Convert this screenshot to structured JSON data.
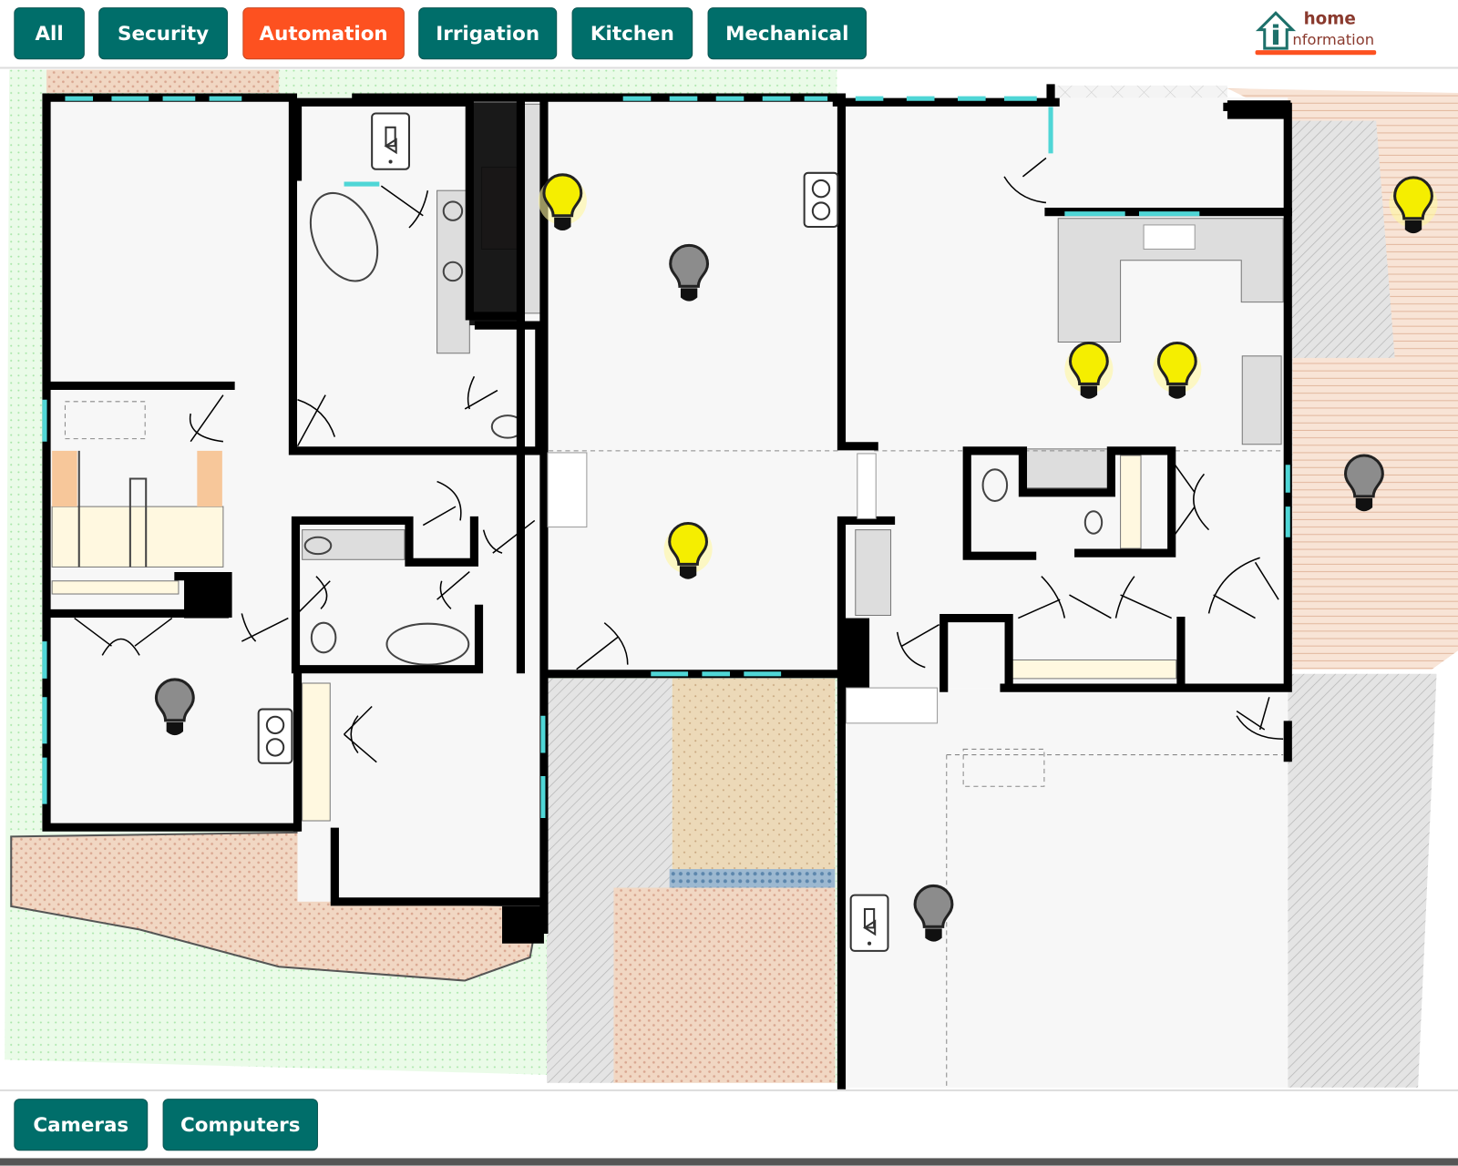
{
  "top_nav": {
    "buttons": [
      {
        "label": "All",
        "active": false
      },
      {
        "label": "Security",
        "active": false
      },
      {
        "label": "Automation",
        "active": true
      },
      {
        "label": "Irrigation",
        "active": false
      },
      {
        "label": "Kitchen",
        "active": false
      },
      {
        "label": "Mechanical",
        "active": false
      }
    ]
  },
  "logo": {
    "line1": "home",
    "line2": "nformation"
  },
  "bottom_nav": {
    "buttons": [
      {
        "label": "Cameras"
      },
      {
        "label": "Computers"
      }
    ]
  },
  "colors": {
    "accent": "#006e6a",
    "active": "#fd5120",
    "light_on": "#f5ee00",
    "light_off": "#8c8c8c"
  },
  "devices": {
    "lights": [
      {
        "state": "on"
      },
      {
        "state": "on"
      },
      {
        "state": "on"
      },
      {
        "state": "on"
      },
      {
        "state": "on"
      },
      {
        "state": "off"
      },
      {
        "state": "off"
      },
      {
        "state": "off"
      },
      {
        "state": "off"
      }
    ],
    "outlets": 2,
    "switches": 2
  }
}
